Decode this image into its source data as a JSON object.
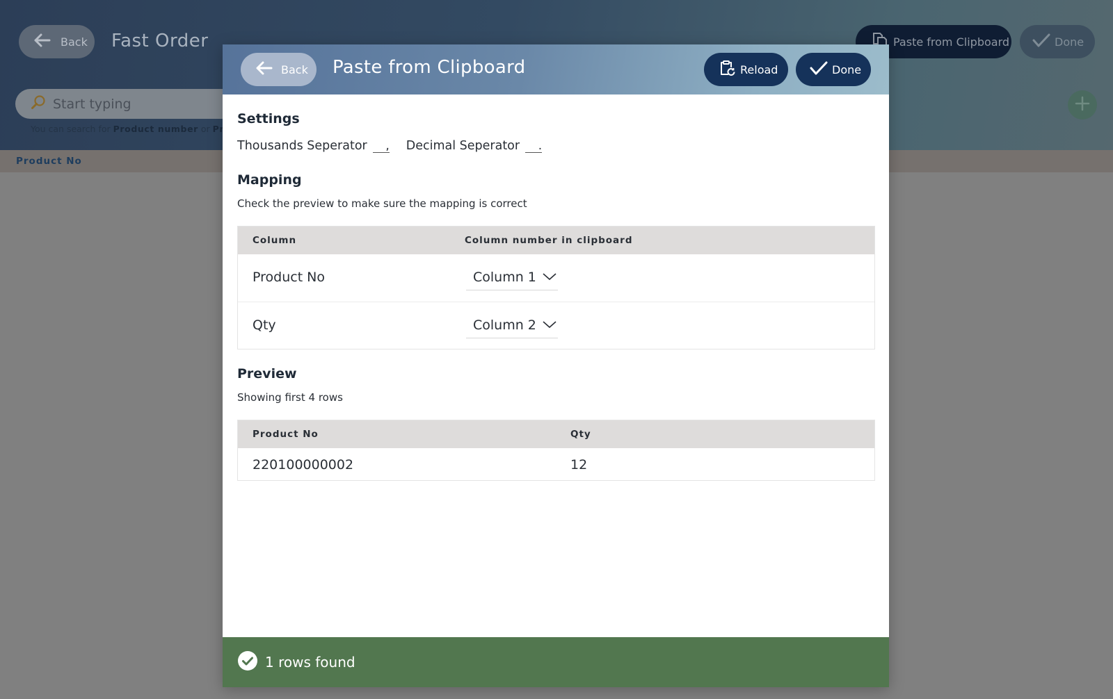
{
  "background": {
    "back_label": "Back",
    "title": "Fast Order",
    "paste_label": "Paste from Clipboard",
    "done_label": "Done",
    "search_placeholder": "Start typing",
    "search_hint_prefix": "You can search for ",
    "search_hint_bold1": "Product number",
    "search_hint_mid": " or ",
    "search_hint_bold2": "Pro",
    "table_column": "Product No"
  },
  "modal": {
    "back_label": "Back",
    "title": "Paste from Clipboard",
    "reload_label": "Reload",
    "done_label": "Done",
    "settings": {
      "title": "Settings",
      "thousands_label": "Thousands Seperator",
      "thousands_value": ",",
      "decimal_label": "Decimal Seperator",
      "decimal_value": "."
    },
    "mapping": {
      "title": "Mapping",
      "subtitle": "Check the preview to make sure the mapping is correct",
      "headers": [
        "Column",
        "Column number in clipboard"
      ],
      "rows": [
        {
          "column": "Product No",
          "selected": "Column 1"
        },
        {
          "column": "Qty",
          "selected": "Column 2"
        }
      ]
    },
    "preview": {
      "title": "Preview",
      "subtitle": "Showing first 4 rows",
      "headers": [
        "Product No",
        "Qty"
      ],
      "rows": [
        {
          "product_no": "220100000002",
          "qty": "12"
        }
      ]
    },
    "status": {
      "text": "1 rows found",
      "color": "#52774f"
    }
  },
  "colors": {
    "primary_button": "#15325a",
    "success": "#52774f"
  }
}
